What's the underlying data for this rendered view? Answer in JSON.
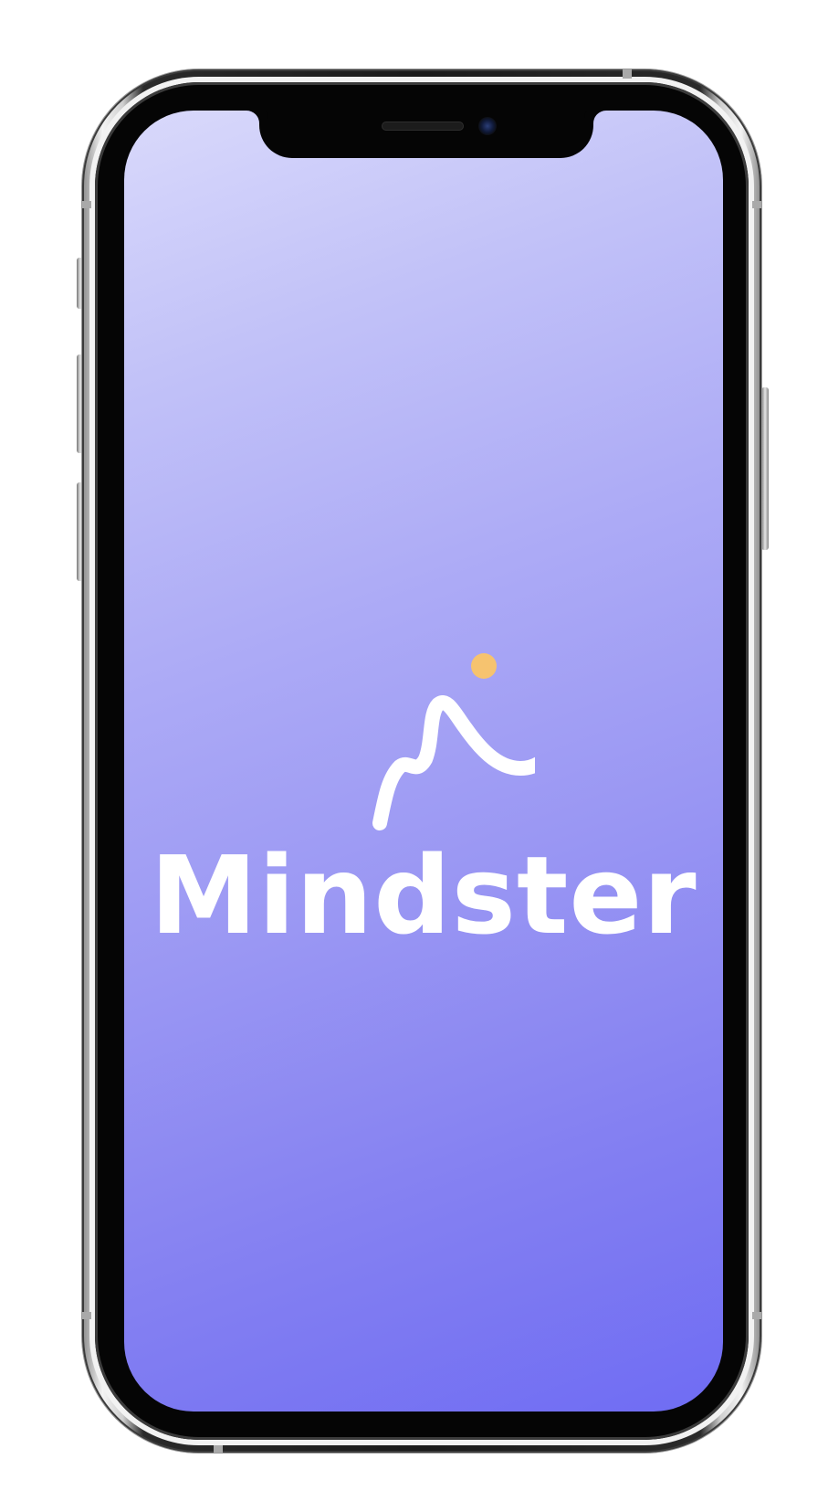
{
  "app": {
    "name": "Mindster"
  },
  "colors": {
    "gradient_start": "#d9d9fb",
    "gradient_end": "#6f6cf3",
    "logo_stroke": "#ffffff",
    "logo_dot": "#f6c36f"
  },
  "icons": {
    "logo": "mindster-mountain-logo"
  }
}
